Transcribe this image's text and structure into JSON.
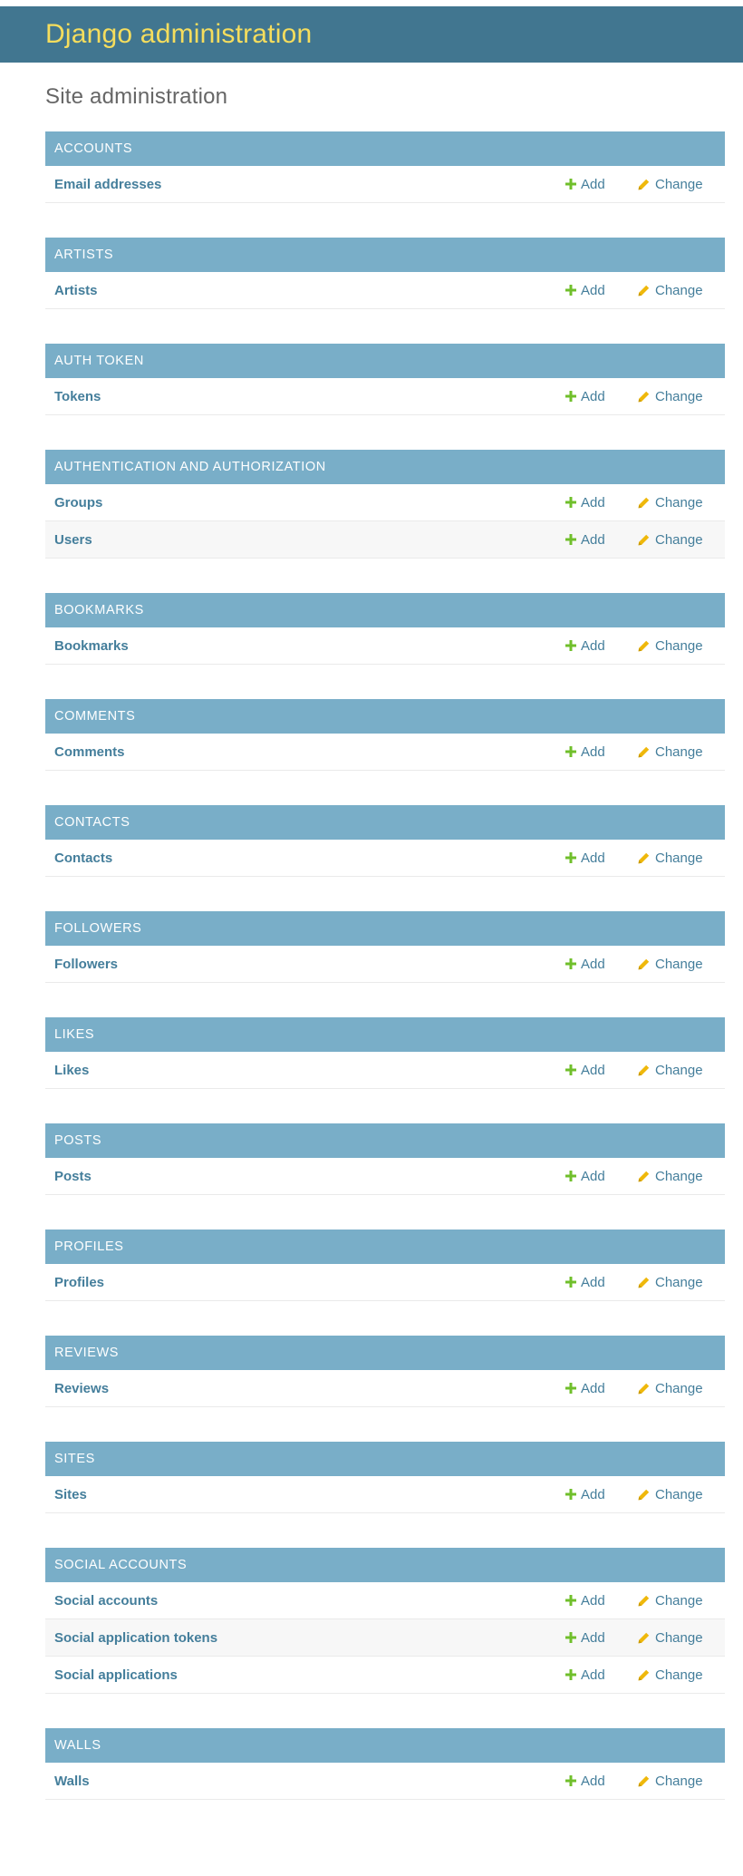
{
  "header": {
    "site_name": "Django administration"
  },
  "page": {
    "title": "Site administration"
  },
  "labels": {
    "add": "Add",
    "change": "Change"
  },
  "colors": {
    "header_bg": "#417690",
    "site_name": "#f5dd5d",
    "caption_bg": "#79aec8",
    "link": "#447e9b",
    "add_icon": "#70bf2b",
    "change_icon": "#efb80b"
  },
  "apps": [
    {
      "name": "Accounts",
      "models": [
        "Email addresses"
      ]
    },
    {
      "name": "Artists",
      "models": [
        "Artists"
      ]
    },
    {
      "name": "Auth Token",
      "models": [
        "Tokens"
      ]
    },
    {
      "name": "Authentication and Authorization",
      "models": [
        "Groups",
        "Users"
      ]
    },
    {
      "name": "Bookmarks",
      "models": [
        "Bookmarks"
      ]
    },
    {
      "name": "Comments",
      "models": [
        "Comments"
      ]
    },
    {
      "name": "Contacts",
      "models": [
        "Contacts"
      ]
    },
    {
      "name": "Followers",
      "models": [
        "Followers"
      ]
    },
    {
      "name": "Likes",
      "models": [
        "Likes"
      ]
    },
    {
      "name": "Posts",
      "models": [
        "Posts"
      ]
    },
    {
      "name": "Profiles",
      "models": [
        "Profiles"
      ]
    },
    {
      "name": "Reviews",
      "models": [
        "Reviews"
      ]
    },
    {
      "name": "Sites",
      "models": [
        "Sites"
      ]
    },
    {
      "name": "Social Accounts",
      "models": [
        "Social accounts",
        "Social application tokens",
        "Social applications"
      ]
    },
    {
      "name": "Walls",
      "models": [
        "Walls"
      ]
    }
  ]
}
